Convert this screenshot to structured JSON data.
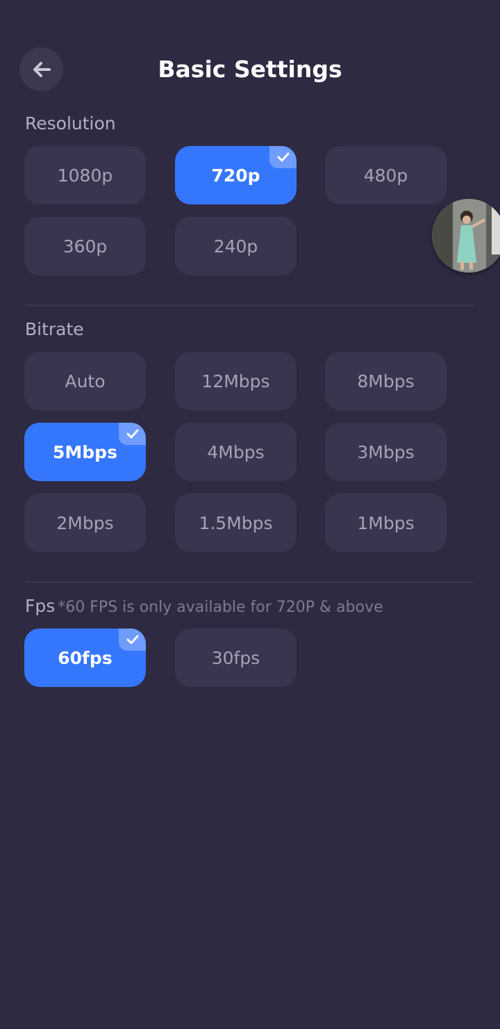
{
  "header": {
    "title": "Basic Settings",
    "back_icon": "arrow-left-icon"
  },
  "resolution": {
    "label": "Resolution",
    "selected": "720p",
    "options": [
      "1080p",
      "720p",
      "480p",
      "360p",
      "240p"
    ]
  },
  "bitrate": {
    "label": "Bitrate",
    "selected": "5Mbps",
    "options": [
      "Auto",
      "12Mbps",
      "8Mbps",
      "5Mbps",
      "4Mbps",
      "3Mbps",
      "2Mbps",
      "1.5Mbps",
      "1Mbps"
    ]
  },
  "fps": {
    "label": "Fps",
    "note": "*60 FPS is only available for 720P & above",
    "selected": "60fps",
    "options": [
      "60fps",
      "30fps"
    ]
  },
  "colors": {
    "background": "#2d2a42",
    "option_bg": "#38354f",
    "selected_bg": "#3577fc",
    "check_badge": "#6f9cfd"
  },
  "icons": {
    "selected_marker": "check-icon",
    "floating_preview": "avatar-thumbnail"
  }
}
